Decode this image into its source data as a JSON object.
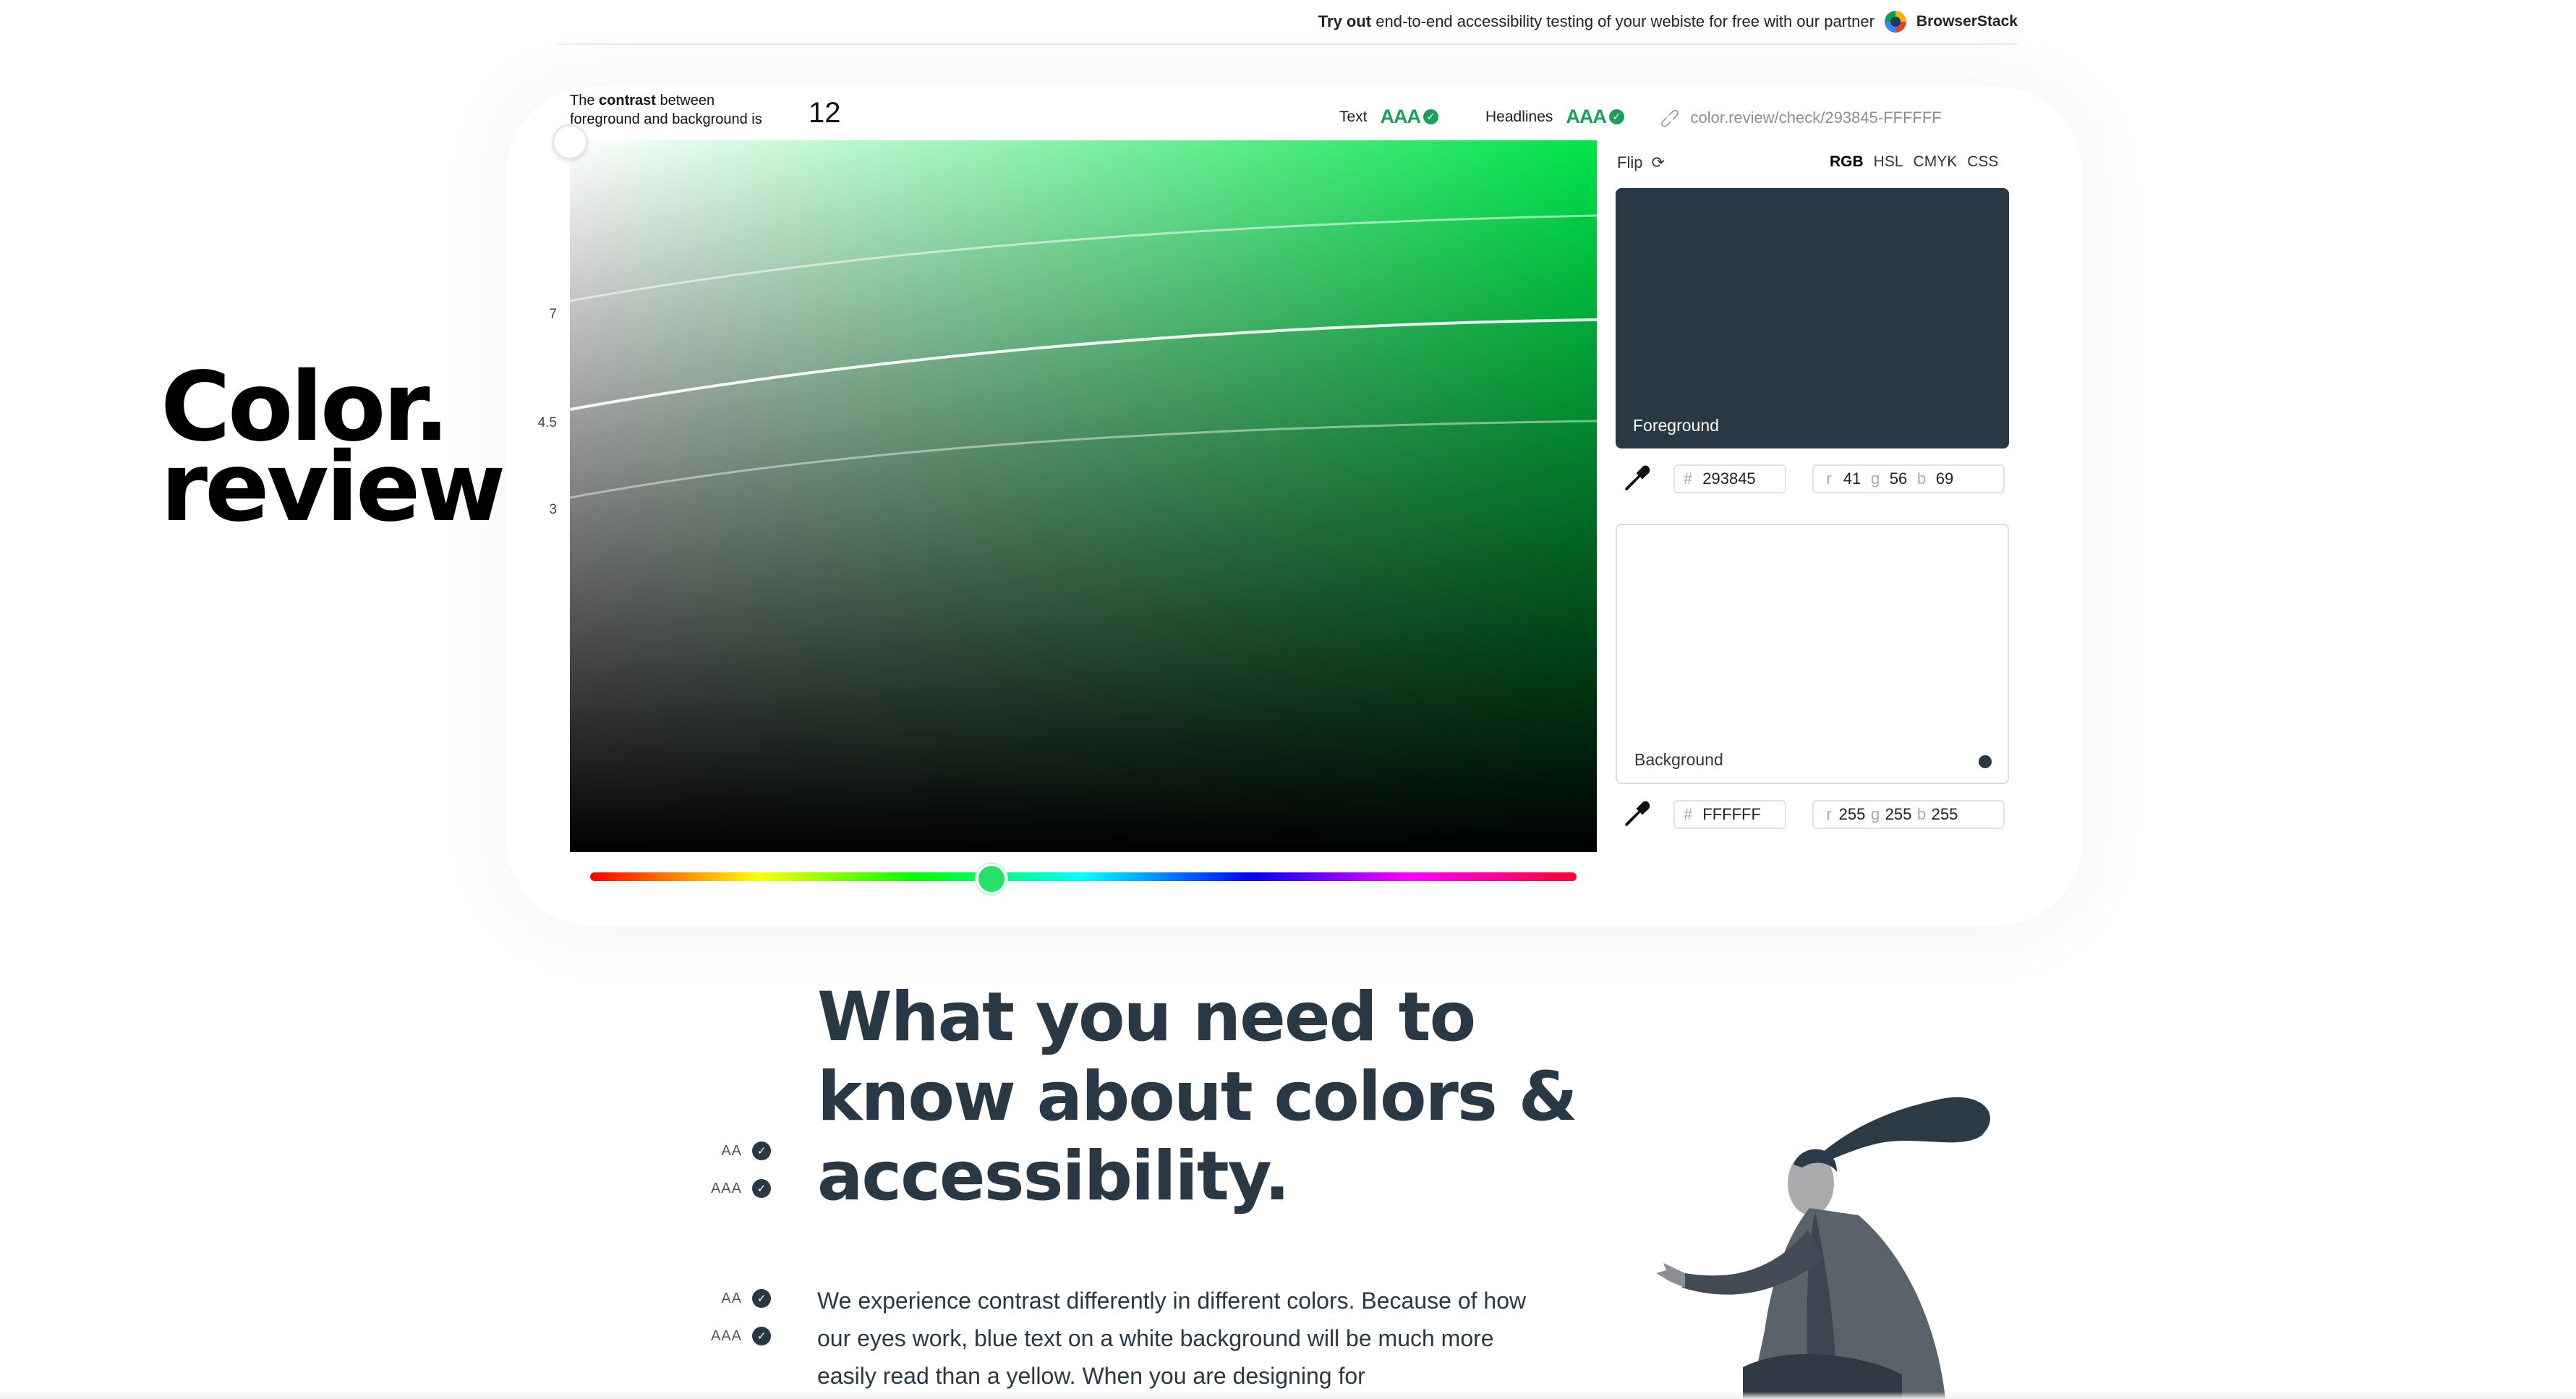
{
  "banner": {
    "try_bold": "Try out",
    "text": "end-to-end accessibility testing of your webiste for free with our partner",
    "partner_name": "BrowserStack"
  },
  "logo": {
    "line1": "Color.",
    "line2": "review"
  },
  "contrast": {
    "label_pre": "The",
    "label_bold": "contrast",
    "label_post": "between",
    "label_line2": "foreground and background is",
    "value": "12"
  },
  "ratings": [
    {
      "label": "Text",
      "score": "AAA"
    },
    {
      "label": "Headlines",
      "score": "AAA"
    }
  ],
  "share_link": "color.review/check/293845-FFFFFF",
  "picker": {
    "hue_color": "#00e34a",
    "y_labels": {
      "aaa": "7",
      "aa": "4.5",
      "large": "3"
    },
    "hue_fraction": 0.405
  },
  "panel": {
    "flip_label": "Flip",
    "modes": [
      "RGB",
      "HSL",
      "CMYK",
      "CSS"
    ],
    "active_mode": "RGB",
    "foreground": {
      "label": "Foreground",
      "color": "#293845",
      "hex_prefix": "#",
      "hex": "293845",
      "r_label": "r",
      "r": "41",
      "g_label": "g",
      "g": "56",
      "b_label": "b",
      "b": "69"
    },
    "background": {
      "label": "Background",
      "color": "#FFFFFF",
      "hex_prefix": "#",
      "hex": "FFFFFF",
      "r_label": "r",
      "r": "255",
      "g_label": "g",
      "g": "255",
      "b_label": "b",
      "b": "255"
    }
  },
  "article": {
    "headline": "What you need to know about colors & accessibility.",
    "paragraph": "We experience contrast differently in different colors. Because of how our eyes work, blue text on a white background will be much more easily read than a yellow. When you are designing for",
    "headline_badges": [
      "AA",
      "AAA"
    ],
    "paragraph_badges": [
      "AA",
      "AAA"
    ]
  }
}
